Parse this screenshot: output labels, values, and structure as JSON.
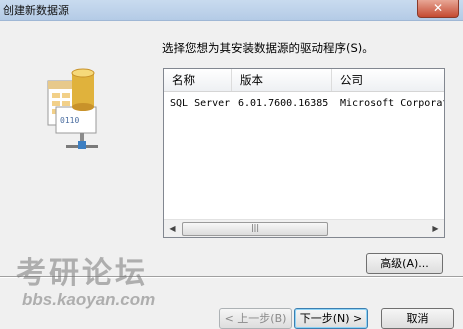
{
  "window": {
    "title": "创建新数据源",
    "close_icon": "close-icon",
    "close_glyph": "✕"
  },
  "prompt": "选择您想为其安装数据源的驱动程序(S)。",
  "driver_list": {
    "columns": [
      "名称",
      "版本",
      "公司"
    ],
    "rows": [
      {
        "name": "SQL Server",
        "version": "6.01.7600.16385",
        "company": "Microsoft Corporation"
      }
    ],
    "scroll_left_glyph": "◀",
    "scroll_right_glyph": "▶",
    "thumb_grip": "|||"
  },
  "buttons": {
    "advanced": "高级(A)...",
    "back": "< 上一步(B)",
    "next": "下一步(N) >",
    "cancel": "取消"
  },
  "watermark": {
    "title": "考研论坛",
    "url": "bbs.kaoyan.com"
  }
}
